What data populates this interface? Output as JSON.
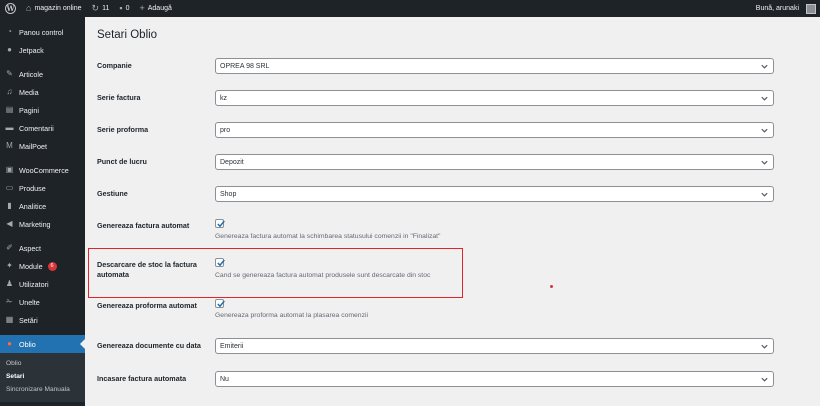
{
  "adminbar": {
    "site_name": "magazin online",
    "updates_count": "11",
    "comments_count": "0",
    "add_new": "Adaugă",
    "greeting": "Bună, arunaki"
  },
  "sidebar": {
    "items": [
      {
        "label": "Panou control",
        "icon": "dashboard-icon"
      },
      {
        "label": "Jetpack",
        "icon": "jetpack-icon"
      },
      {
        "label": "Articole",
        "icon": "pin-icon"
      },
      {
        "label": "Media",
        "icon": "media-icon"
      },
      {
        "label": "Pagini",
        "icon": "pages-icon"
      },
      {
        "label": "Comentarii",
        "icon": "comments-icon"
      },
      {
        "label": "MailPoet",
        "icon": "mailpoet-icon"
      },
      {
        "label": "WooCommerce",
        "icon": "woocommerce-icon"
      },
      {
        "label": "Produse",
        "icon": "products-icon"
      },
      {
        "label": "Analitice",
        "icon": "analytics-icon"
      },
      {
        "label": "Marketing",
        "icon": "marketing-icon"
      },
      {
        "label": "Aspect",
        "icon": "appearance-icon"
      },
      {
        "label": "Module",
        "icon": "plugins-icon",
        "badge": "6"
      },
      {
        "label": "Utilizatori",
        "icon": "users-icon"
      },
      {
        "label": "Unelte",
        "icon": "tools-icon"
      },
      {
        "label": "Setări",
        "icon": "settings-icon"
      },
      {
        "label": "Oblio",
        "icon": "oblio-icon"
      }
    ],
    "submenu": [
      "Oblio",
      "Setari",
      "Sincronizare Manuala"
    ]
  },
  "main": {
    "title": "Setari Oblio",
    "rows": [
      {
        "label": "Companie",
        "value": "OPREA 98 SRL"
      },
      {
        "label": "Serie factura",
        "value": "kz"
      },
      {
        "label": "Serie proforma",
        "value": "pro"
      },
      {
        "label": "Punct de lucru",
        "value": "Depozit"
      },
      {
        "label": "Gestiune",
        "value": "Shop"
      },
      {
        "label": "Genereaza factura automat",
        "checked": true,
        "desc": "Genereaza factura automat la schimbarea statusului comenzii in \"Finalizat\""
      },
      {
        "label": "Descarcare de stoc la factura automata",
        "checked": true,
        "desc": "Cand se genereaza factura automat produsele sunt descarcate din stoc"
      },
      {
        "label": "Genereaza proforma automat",
        "checked": true,
        "desc": "Genereaza proforma automat la plasarea comenzii"
      },
      {
        "label": "Genereaza documente cu data",
        "value": "Emiterii"
      },
      {
        "label": "Incasare factura automata",
        "value": "Nu"
      }
    ]
  },
  "colors": {
    "accent": "#2271b1",
    "highlight": "#e0242b",
    "adminbar": "#1d2327"
  }
}
